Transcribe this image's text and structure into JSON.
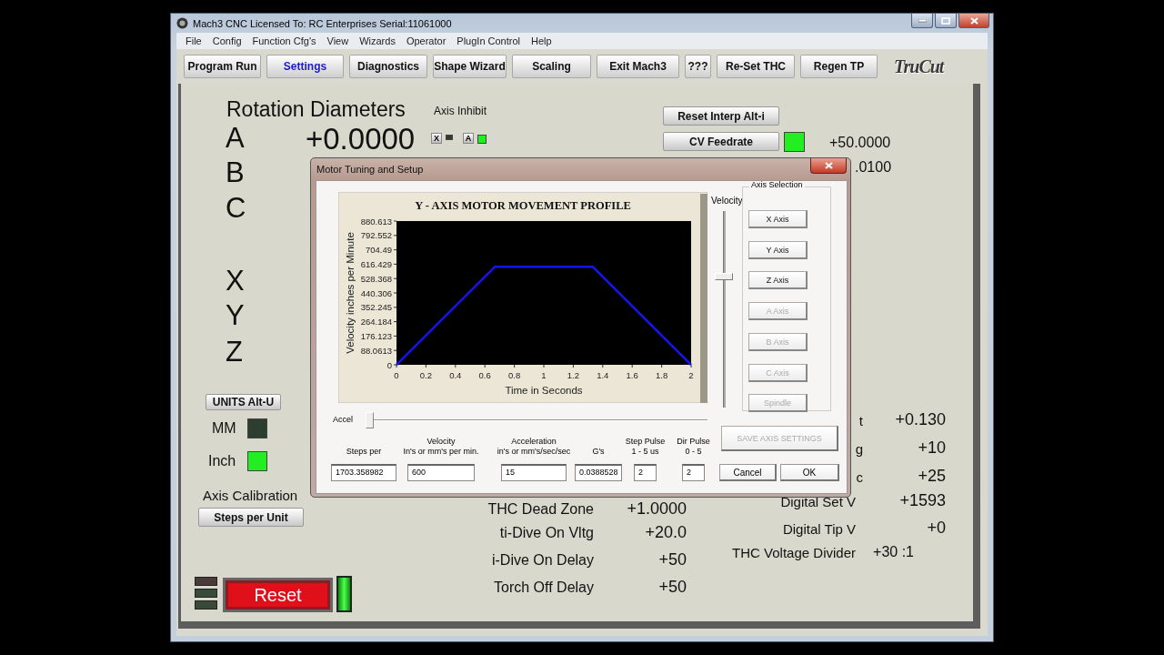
{
  "window": {
    "title": "Mach3 CNC  Licensed To: RC Enterprises Serial:11061000"
  },
  "menu": [
    "File",
    "Config",
    "Function Cfg's",
    "View",
    "Wizards",
    "Operator",
    "PlugIn Control",
    "Help"
  ],
  "nav_tabs": [
    {
      "label": "Program Run",
      "selected": false
    },
    {
      "label": "Settings",
      "selected": true
    },
    {
      "label": "Diagnostics",
      "selected": false
    },
    {
      "label": "Shape Wizard",
      "selected": false
    },
    {
      "label": "Scaling",
      "selected": false
    },
    {
      "label": "Exit Mach3",
      "selected": false
    },
    {
      "label": "???",
      "selected": false
    },
    {
      "label": "Re-Set THC",
      "selected": false
    },
    {
      "label": "Regen TP",
      "selected": false
    }
  ],
  "logo_text": "TruCut",
  "rotation": {
    "title": "Rotation Diameters",
    "value": "+0.0000",
    "axes": [
      "A",
      "B",
      "C"
    ]
  },
  "linear_axes": [
    "X",
    "Y",
    "Z"
  ],
  "axis_inhibit": {
    "title": "Axis Inhibit",
    "items": [
      {
        "label": "X",
        "on": false
      },
      {
        "label": "A",
        "on": true
      }
    ]
  },
  "reset_interp": "Reset Interp Alt-i",
  "cv_feedrate": {
    "label": "CV Feedrate",
    "on": true,
    "value": "+50.0000"
  },
  "hidden_value": ".0100",
  "units": {
    "button": "UNITS Alt-U",
    "options": [
      {
        "label": "MM",
        "on": false
      },
      {
        "label": "Inch",
        "on": true
      }
    ]
  },
  "axis_calibration": {
    "title": "Axis Calibration",
    "button": "Steps per Unit"
  },
  "reset": {
    "label": "Reset",
    "on": true
  },
  "thc_params": [
    {
      "label": "THC Dead Zone",
      "value": "+1.0000"
    },
    {
      "label": "ti-Dive On Vltg",
      "value": "+20.0"
    },
    {
      "label": "i-Dive On Delay",
      "value": "+50"
    },
    {
      "label": "Torch Off Delay",
      "value": "+50"
    }
  ],
  "right_params": [
    {
      "label": "t",
      "value": "+0.130"
    },
    {
      "label": "g",
      "value": "+10"
    },
    {
      "label": "c",
      "value": "+25"
    },
    {
      "label": "Digital Set V",
      "value": "+1593"
    },
    {
      "label": "Digital Tip V",
      "value": "+0"
    },
    {
      "label": "THC Voltage Divider",
      "value": "+30 :1"
    }
  ],
  "dialog": {
    "title": "Motor Tuning and Setup",
    "chart_data": {
      "type": "line",
      "title": "Y - AXIS MOTOR MOVEMENT PROFILE",
      "xlabel": "Time in Seconds",
      "ylabel": "Velocity inches per Minute",
      "x": [
        0,
        0.667,
        1.333,
        2
      ],
      "values": [
        0,
        600,
        600,
        0
      ],
      "xlim": [
        0,
        2
      ],
      "ylim": [
        0,
        880.613
      ],
      "xticks": [
        0,
        0.2,
        0.4,
        0.6,
        0.8,
        1,
        1.2,
        1.4,
        1.6,
        1.8,
        2
      ],
      "yticks": [
        0,
        88.0613,
        176.123,
        264.184,
        352.245,
        440.306,
        528.368,
        616.429,
        704.49,
        792.552,
        880.613
      ]
    },
    "velocity_slider": {
      "label": "Velocity",
      "level": 0.67
    },
    "accel_slider": {
      "label": "Accel",
      "level": 0
    },
    "axis_selection": {
      "title": "Axis Selection",
      "buttons": [
        {
          "label": "X Axis",
          "disabled": false
        },
        {
          "label": "Y Axis",
          "disabled": false
        },
        {
          "label": "Z Axis",
          "disabled": false
        },
        {
          "label": "A Axis",
          "disabled": true
        },
        {
          "label": "B Axis",
          "disabled": true
        },
        {
          "label": "C Axis",
          "disabled": true
        },
        {
          "label": "Spindle",
          "disabled": true
        }
      ]
    },
    "save_button": {
      "label": "SAVE AXIS SETTINGS",
      "disabled": true
    },
    "fields": [
      {
        "label": "Steps per",
        "value": "1703.358982"
      },
      {
        "label": "Velocity",
        "note": "In's or mm's per min.",
        "value": "600"
      },
      {
        "label": "Acceleration",
        "note": "in's or mm's/sec/sec",
        "value": "15"
      },
      {
        "label": "G's",
        "value": "0.0388528"
      },
      {
        "label": "Step Pulse",
        "note": "1 - 5 us",
        "value": "2"
      },
      {
        "label": "Dir Pulse",
        "note": "0 - 5",
        "value": "2"
      }
    ],
    "buttons": [
      "Cancel",
      "OK"
    ]
  }
}
